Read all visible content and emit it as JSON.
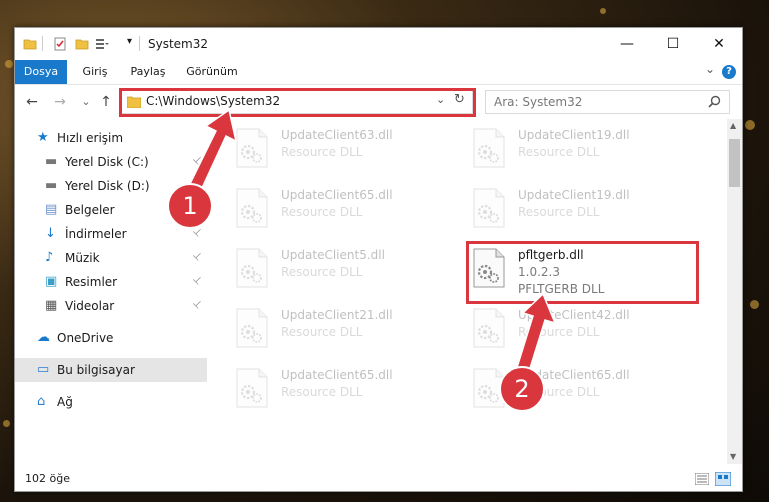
{
  "window": {
    "title": "System32",
    "controls": {
      "minimize": "—",
      "maximize": "☐",
      "close": "✕"
    }
  },
  "ribbon": {
    "tabs": [
      "Dosya",
      "Giriş",
      "Paylaş",
      "Görünüm"
    ],
    "active_tab": "Dosya",
    "expand_glyph": "⌄",
    "help_glyph": "?"
  },
  "nav": {
    "back_glyph": "←",
    "forward_glyph": "→",
    "recent_glyph": "⌄",
    "up_glyph": "↑",
    "address": "C:\\Windows\\System32",
    "search_placeholder": "Ara: System32"
  },
  "sidebar": {
    "items": [
      {
        "label": "Hızlı erişim",
        "icon": "star-icon",
        "pinned": false
      },
      {
        "label": "Yerel Disk (C:)",
        "icon": "drive-icon",
        "pinned": true
      },
      {
        "label": "Yerel Disk (D:)",
        "icon": "drive-icon",
        "pinned": true
      },
      {
        "label": "Belgeler",
        "icon": "documents-icon",
        "pinned": true
      },
      {
        "label": "İndirmeler",
        "icon": "download-icon",
        "pinned": true
      },
      {
        "label": "Müzik",
        "icon": "music-icon",
        "pinned": true
      },
      {
        "label": "Resimler",
        "icon": "pictures-icon",
        "pinned": true
      },
      {
        "label": "Videolar",
        "icon": "videos-icon",
        "pinned": true
      },
      {
        "label": "OneDrive",
        "icon": "cloud-icon",
        "pinned": false
      },
      {
        "label": "Bu bilgisayar",
        "icon": "computer-icon",
        "pinned": false,
        "selected": true
      },
      {
        "label": "Ağ",
        "icon": "network-icon",
        "pinned": false
      }
    ],
    "pin_glyph": "📌"
  },
  "files": [
    {
      "name": "UpdateClient63.dll",
      "type": "Resource DLL"
    },
    {
      "name": "UpdateClient19.dll",
      "type": "Resource DLL"
    },
    {
      "name": "UpdateClient65.dll",
      "type": "Resource DLL"
    },
    {
      "name": "UpdateClient19.dll",
      "type": "Resource DLL"
    },
    {
      "name": "UpdateClient5.dll",
      "type": "Resource DLL"
    },
    {
      "name": "pfltgerb.dll",
      "version": "1.0.2.3",
      "type": "PFLTGERB DLL",
      "highlighted": true
    },
    {
      "name": "UpdateClient21.dll",
      "type": "Resource DLL"
    },
    {
      "name": "UpdateClient42.dll",
      "type": "Resource DLL"
    },
    {
      "name": "UpdateClient65.dll",
      "type": "Resource DLL"
    },
    {
      "name": "UpdateClient65.dll",
      "type": "Resource DLL"
    }
  ],
  "status": {
    "item_count": "102 öğe"
  },
  "annotations": {
    "badge1": "1",
    "badge2": "2",
    "color": "#d9363e"
  },
  "colors": {
    "accent": "#1979ca",
    "annotation": "#d9363e"
  }
}
